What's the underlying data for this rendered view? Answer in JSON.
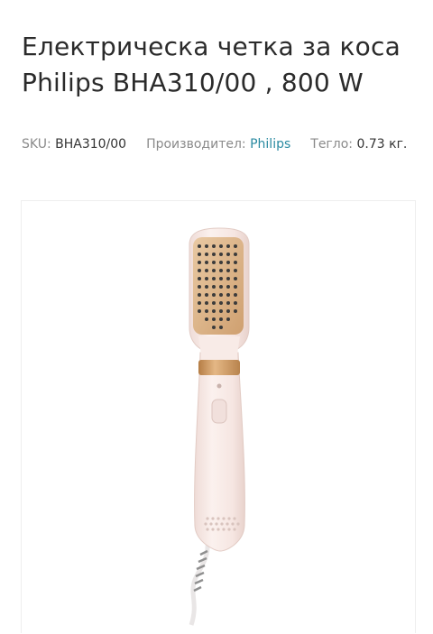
{
  "product": {
    "title": "Електрическа четка за коса Philips BHA310/00 , 800 W",
    "sku_label": "SKU:",
    "sku_value": "BHA310/00",
    "manufacturer_label": "Производител:",
    "manufacturer_value": "Philips",
    "weight_label": "Тегло:",
    "weight_value": "0.73",
    "weight_unit": "кг."
  },
  "colors": {
    "text": "#2b2b2b",
    "muted": "#8a8a8a",
    "link": "#2a8aa1",
    "accent_gold": "#c9955a",
    "device_body": "#f6e8e4"
  }
}
